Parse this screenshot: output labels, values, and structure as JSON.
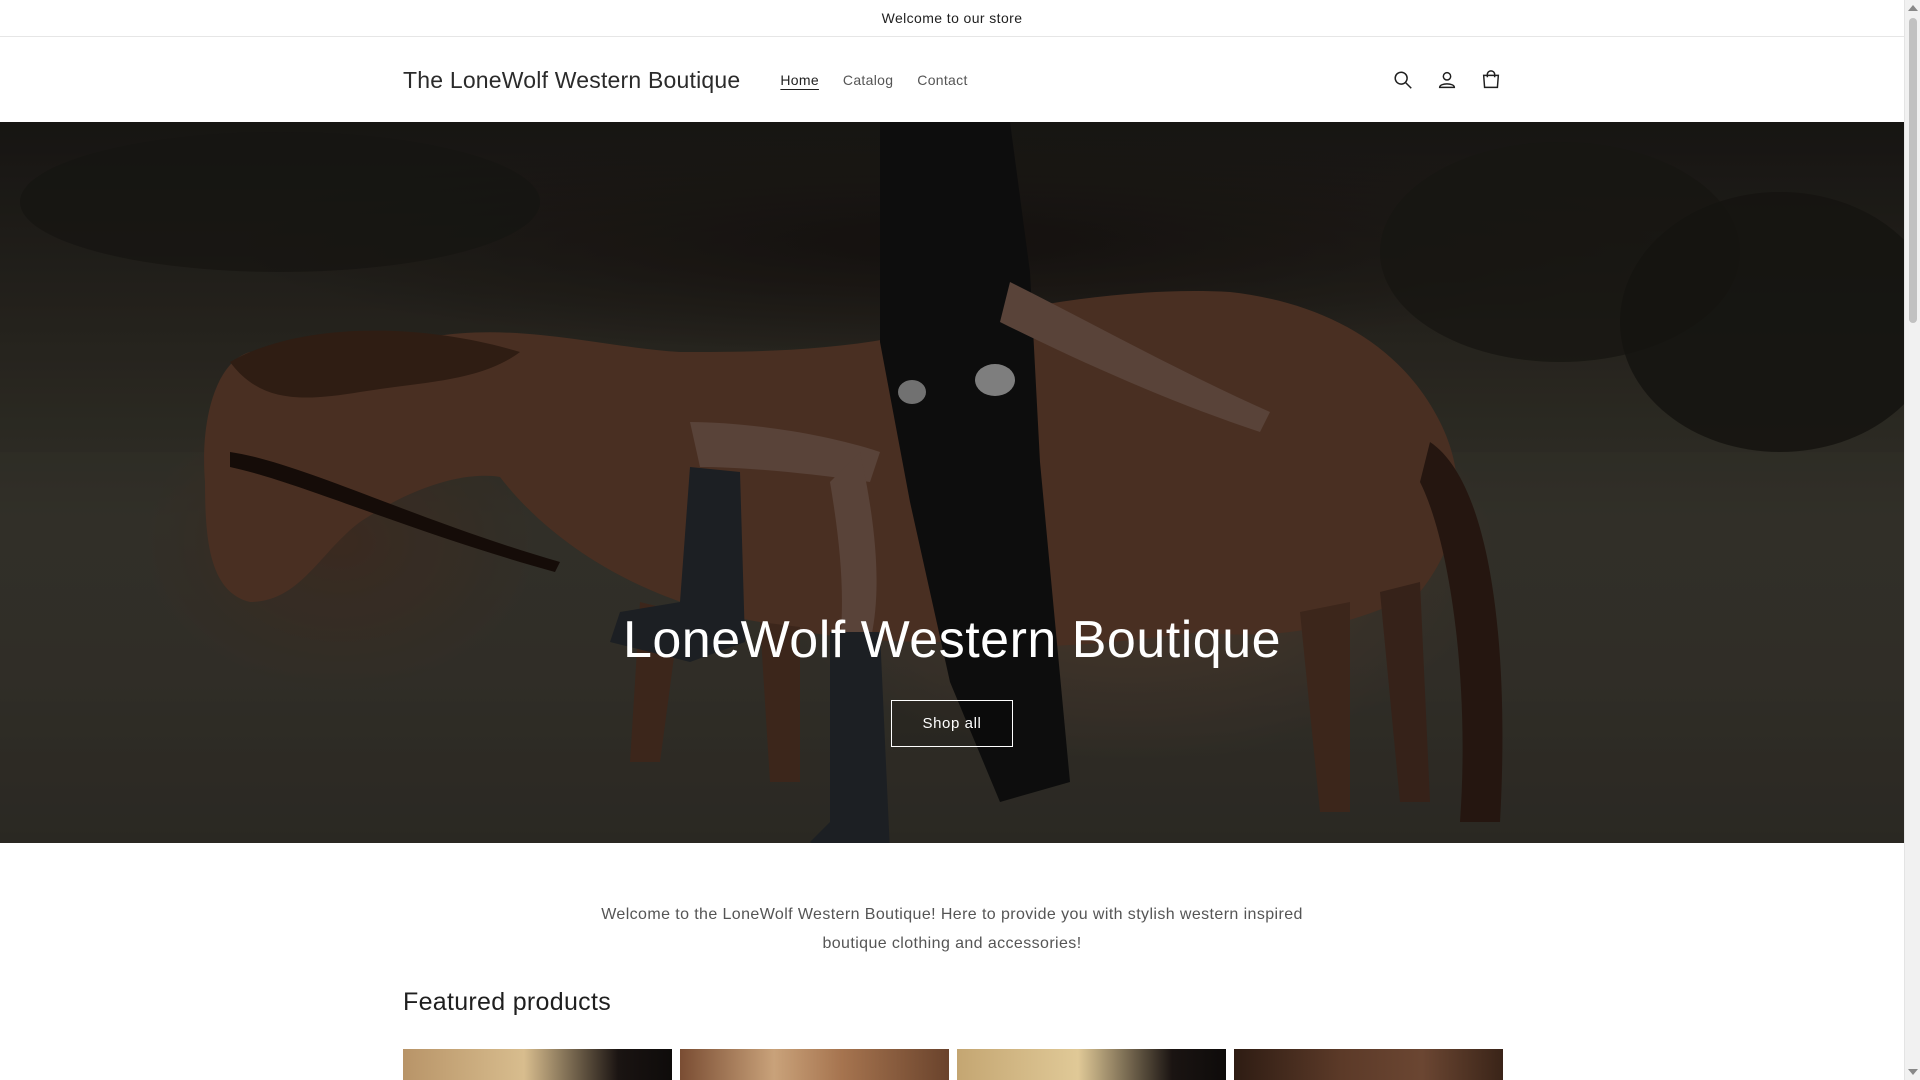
{
  "announcement": {
    "text": "Welcome to our store"
  },
  "header": {
    "logo": "The LoneWolf Western Boutique",
    "nav": [
      {
        "label": "Home",
        "active": true
      },
      {
        "label": "Catalog",
        "active": false
      },
      {
        "label": "Contact",
        "active": false
      }
    ],
    "icons": [
      "search-icon",
      "account-icon",
      "cart-icon"
    ]
  },
  "hero": {
    "title": "LoneWolf Western Boutique",
    "button_label": "Shop all"
  },
  "intro": {
    "text": "Welcome to the LoneWolf Western Boutique! Here to provide you with stylish western inspired boutique clothing and accessories!"
  },
  "featured": {
    "title": "Featured products",
    "products": [
      {
        "image_colors": [
          "#c8a878",
          "#1a1412"
        ]
      },
      {
        "image_colors": [
          "#8a5a3c",
          "#c9a27a"
        ]
      },
      {
        "image_colors": [
          "#d4b98a",
          "#1a1412"
        ]
      },
      {
        "image_colors": [
          "#3a2418",
          "#6b4632"
        ]
      }
    ]
  },
  "colors": {
    "accent": "#121212",
    "hero_text": "#ffffff"
  }
}
